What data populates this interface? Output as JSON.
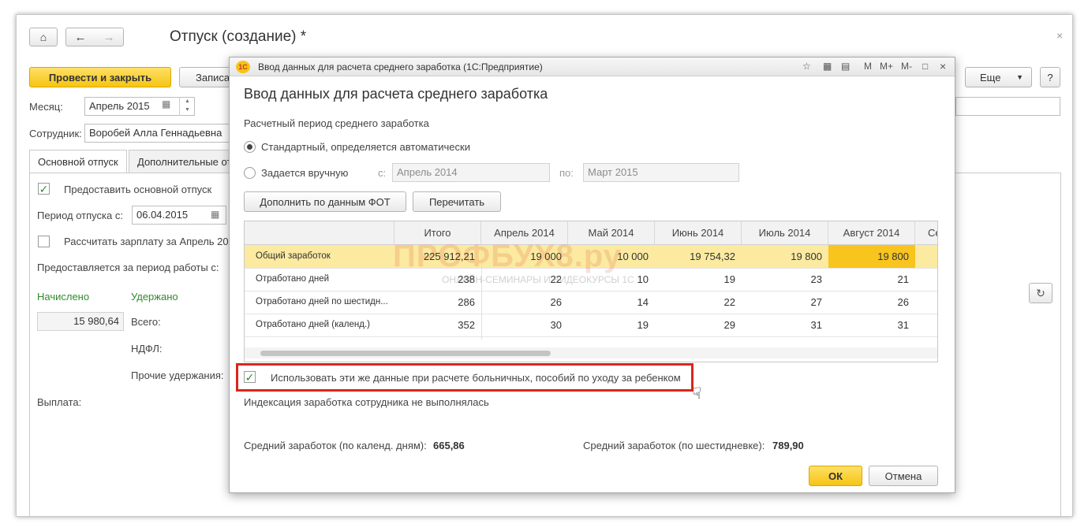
{
  "main": {
    "title": "Отпуск (создание) *",
    "toolbar": {
      "post_close": "Провести и закрыть",
      "save": "Записать",
      "more": "Еще",
      "help": "?"
    },
    "month_label": "Месяц:",
    "month_value": "Апрель 2015",
    "employee_label": "Сотрудник:",
    "employee_value": "Воробей Алла Геннадьевна",
    "tabs": [
      "Основной отпуск",
      "Дополнительные отпуска"
    ],
    "grant_main_leave": "Предоставить основной отпуск",
    "leave_period_label": "Период отпуска с:",
    "leave_period_from": "06.04.2015",
    "calc_salary": "Рассчитать зарплату за Апрель 2015",
    "work_period_label": "Предоставляется за период работы с:",
    "accrued_label": "Начислено",
    "withheld_label": "Удержано",
    "accrued_value": "15 980,64",
    "total_label": "Всего:",
    "ndfl_label": "НДФЛ:",
    "other_withholdings_label": "Прочие удержания:",
    "payment_label": "Выплата:"
  },
  "dialog": {
    "window_title": "Ввод данных для расчета среднего заработка  (1С:Предприятие)",
    "logo": "1С",
    "titlebar_icons": [
      "M",
      "M+",
      "M-"
    ],
    "heading": "Ввод данных для расчета среднего заработка",
    "period_section": "Расчетный период среднего заработка",
    "radio_standard": "Стандартный, определяется автоматически",
    "radio_manual": "Задается вручную",
    "from_label": "с:",
    "from_value": "Апрель 2014",
    "to_label": "по:",
    "to_value": "Март 2015",
    "fill_fot_button": "Дополнить по данным ФОТ",
    "recalc_button": "Перечитать",
    "use_data_checkbox": "Использовать эти же данные при расчете больничных, пособий по уходу за ребенком",
    "indexation_note": "Индексация заработка сотрудника не выполнялась",
    "avg_calendar_label": "Средний заработок (по календ. дням):",
    "avg_calendar_value": "665,86",
    "avg_sixday_label": "Средний заработок (по шестидневке):",
    "avg_sixday_value": "789,90",
    "ok_button": "ОК",
    "cancel_button": "Отмена",
    "grid": {
      "columns": [
        "",
        "Итого",
        "Апрель 2014",
        "Май 2014",
        "Июнь 2014",
        "Июль 2014",
        "Август 2014",
        "Се"
      ],
      "rows": [
        {
          "name": "Общий заработок",
          "cells": [
            "225 912,21",
            "19 000",
            "10 000",
            "19 754,32",
            "19 800",
            "19 800"
          ]
        },
        {
          "name": "Отработано дней",
          "cells": [
            "238",
            "22",
            "10",
            "19",
            "23",
            "21"
          ]
        },
        {
          "name": "Отработано дней по шестидн...",
          "cells": [
            "286",
            "26",
            "14",
            "22",
            "27",
            "26"
          ]
        },
        {
          "name": "Отработано дней (календ.)",
          "cells": [
            "352",
            "30",
            "19",
            "29",
            "31",
            "31"
          ]
        }
      ]
    }
  },
  "watermark": {
    "brand": "ПРОФБУХ8.ру",
    "tagline": "ОНЛАЙН-СЕМИНАРЫ И ВИДЕОКУРСЫ 1С"
  },
  "colors": {
    "accent_yellow": "#f6c414",
    "highlight_border": "#d9261c",
    "selected_row": "#fbeaa0",
    "green_label": "#2e8b2e"
  }
}
